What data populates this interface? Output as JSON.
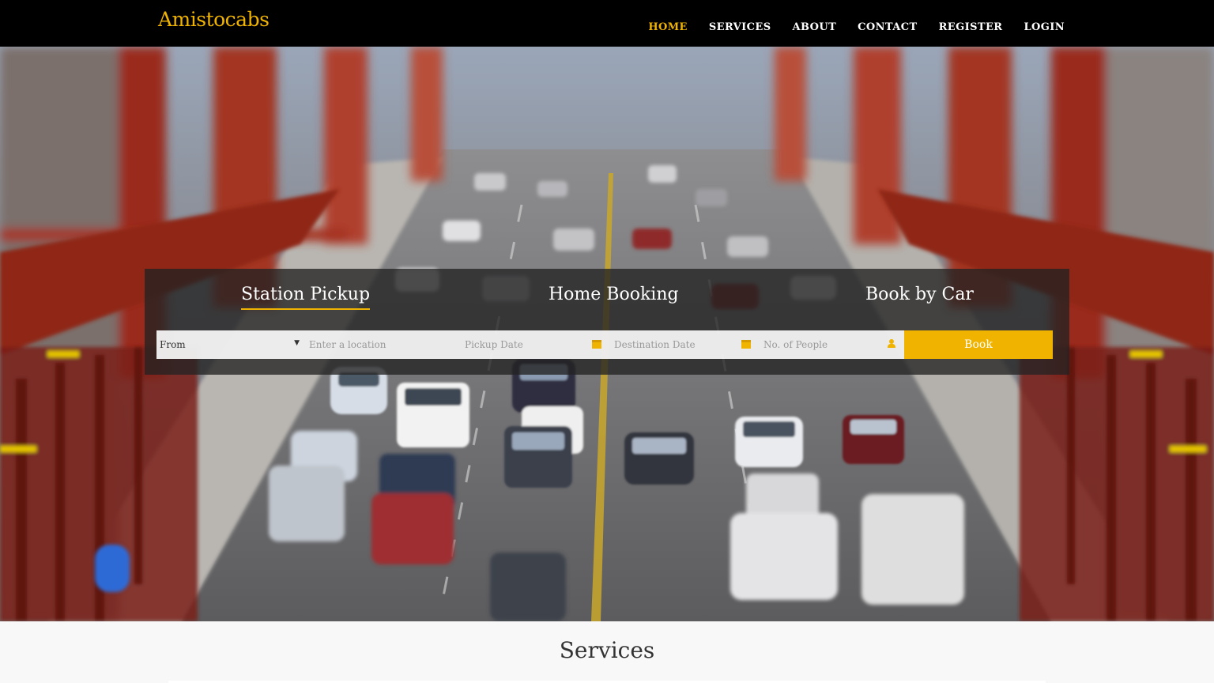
{
  "brand": {
    "name": "Amistocabs"
  },
  "nav": {
    "items": [
      {
        "label": "HOME",
        "active": true
      },
      {
        "label": "SERVICES",
        "active": false
      },
      {
        "label": "ABOUT",
        "active": false
      },
      {
        "label": "CONTACT",
        "active": false
      },
      {
        "label": "REGISTER",
        "active": false
      },
      {
        "label": "LOGIN",
        "active": false
      }
    ]
  },
  "hero": {
    "background_description_icon": "bridge-traffic-photo"
  },
  "booking": {
    "tabs": [
      {
        "label": "Station Pickup",
        "active": true
      },
      {
        "label": "Home Booking",
        "active": false
      },
      {
        "label": "Book by Car",
        "active": false
      }
    ],
    "from_select": {
      "value": "From"
    },
    "location": {
      "placeholder": "Enter a location"
    },
    "pickup_date": {
      "placeholder": "Pickup Date"
    },
    "destination_date": {
      "placeholder": "Destination Date"
    },
    "people": {
      "placeholder": "No. of People"
    },
    "book_label": "Book"
  },
  "services": {
    "title": "Services"
  },
  "colors": {
    "accent": "#f0b400",
    "navbar": "#000000",
    "panel": "#232323"
  }
}
